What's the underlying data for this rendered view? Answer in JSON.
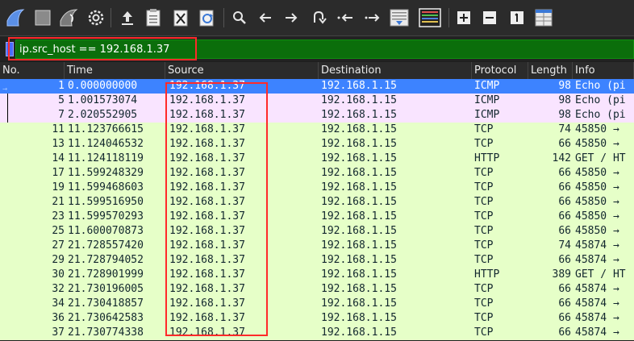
{
  "toolbar": {
    "icons": [
      "shark-fin-start-icon",
      "stop-icon",
      "shark-fin-restart-icon",
      "options-gear-icon",
      "open-file-icon",
      "save-file-icon",
      "close-file-icon",
      "reload-icon",
      "find-icon",
      "go-back-icon",
      "go-forward-icon",
      "go-to-packet-icon",
      "first-packet-icon",
      "last-packet-icon",
      "autoscroll-icon",
      "colorize-icon",
      "zoom-in-icon",
      "zoom-out-icon",
      "normal-size-icon",
      "resize-columns-icon"
    ]
  },
  "filter": {
    "value": "ip.src_host == 192.168.1.37"
  },
  "columns": {
    "no": "No.",
    "time": "Time",
    "source": "Source",
    "destination": "Destination",
    "protocol": "Protocol",
    "length": "Length",
    "info": "Info"
  },
  "colors": {
    "selected_row": "#3d83ff",
    "icmp_row": "#f9e4ff",
    "tcp_row": "#e6ffc8",
    "filter_ok": "#0b6e0b",
    "highlight_box": "#ff2a2a"
  },
  "rows": [
    {
      "no": "1",
      "time": "0.000000000",
      "source": "192.168.1.37",
      "destination": "192.168.1.15",
      "protocol": "ICMP",
      "length": "98",
      "info": "Echo (pi",
      "kind": "selected"
    },
    {
      "no": "5",
      "time": "1.001573074",
      "source": "192.168.1.37",
      "destination": "192.168.1.15",
      "protocol": "ICMP",
      "length": "98",
      "info": "Echo (pi",
      "kind": "icmp"
    },
    {
      "no": "7",
      "time": "2.020552905",
      "source": "192.168.1.37",
      "destination": "192.168.1.15",
      "protocol": "ICMP",
      "length": "98",
      "info": "Echo (pi",
      "kind": "icmp"
    },
    {
      "no": "11",
      "time": "11.123766615",
      "source": "192.168.1.37",
      "destination": "192.168.1.15",
      "protocol": "TCP",
      "length": "74",
      "info": "45850 →",
      "kind": "tcp"
    },
    {
      "no": "13",
      "time": "11.124046532",
      "source": "192.168.1.37",
      "destination": "192.168.1.15",
      "protocol": "TCP",
      "length": "66",
      "info": "45850 →",
      "kind": "tcp"
    },
    {
      "no": "14",
      "time": "11.124118119",
      "source": "192.168.1.37",
      "destination": "192.168.1.15",
      "protocol": "HTTP",
      "length": "142",
      "info": "GET / HT",
      "kind": "tcp"
    },
    {
      "no": "17",
      "time": "11.599248329",
      "source": "192.168.1.37",
      "destination": "192.168.1.15",
      "protocol": "TCP",
      "length": "66",
      "info": "45850 →",
      "kind": "tcp"
    },
    {
      "no": "19",
      "time": "11.599468603",
      "source": "192.168.1.37",
      "destination": "192.168.1.15",
      "protocol": "TCP",
      "length": "66",
      "info": "45850 →",
      "kind": "tcp"
    },
    {
      "no": "21",
      "time": "11.599516950",
      "source": "192.168.1.37",
      "destination": "192.168.1.15",
      "protocol": "TCP",
      "length": "66",
      "info": "45850 →",
      "kind": "tcp"
    },
    {
      "no": "23",
      "time": "11.599570293",
      "source": "192.168.1.37",
      "destination": "192.168.1.15",
      "protocol": "TCP",
      "length": "66",
      "info": "45850 →",
      "kind": "tcp"
    },
    {
      "no": "25",
      "time": "11.600070873",
      "source": "192.168.1.37",
      "destination": "192.168.1.15",
      "protocol": "TCP",
      "length": "66",
      "info": "45850 →",
      "kind": "tcp"
    },
    {
      "no": "27",
      "time": "21.728557420",
      "source": "192.168.1.37",
      "destination": "192.168.1.15",
      "protocol": "TCP",
      "length": "74",
      "info": "45874 →",
      "kind": "tcp"
    },
    {
      "no": "29",
      "time": "21.728794052",
      "source": "192.168.1.37",
      "destination": "192.168.1.15",
      "protocol": "TCP",
      "length": "66",
      "info": "45874 →",
      "kind": "tcp"
    },
    {
      "no": "30",
      "time": "21.728901999",
      "source": "192.168.1.37",
      "destination": "192.168.1.15",
      "protocol": "HTTP",
      "length": "389",
      "info": "GET / HT",
      "kind": "tcp"
    },
    {
      "no": "32",
      "time": "21.730196005",
      "source": "192.168.1.37",
      "destination": "192.168.1.15",
      "protocol": "TCP",
      "length": "66",
      "info": "45874 →",
      "kind": "tcp"
    },
    {
      "no": "34",
      "time": "21.730418857",
      "source": "192.168.1.37",
      "destination": "192.168.1.15",
      "protocol": "TCP",
      "length": "66",
      "info": "45874 →",
      "kind": "tcp"
    },
    {
      "no": "36",
      "time": "21.730642583",
      "source": "192.168.1.37",
      "destination": "192.168.1.15",
      "protocol": "TCP",
      "length": "66",
      "info": "45874 →",
      "kind": "tcp"
    },
    {
      "no": "37",
      "time": "21.730774338",
      "source": "192.168.1.37",
      "destination": "192.168.1.15",
      "protocol": "TCP",
      "length": "66",
      "info": "45874 →",
      "kind": "tcp"
    }
  ]
}
